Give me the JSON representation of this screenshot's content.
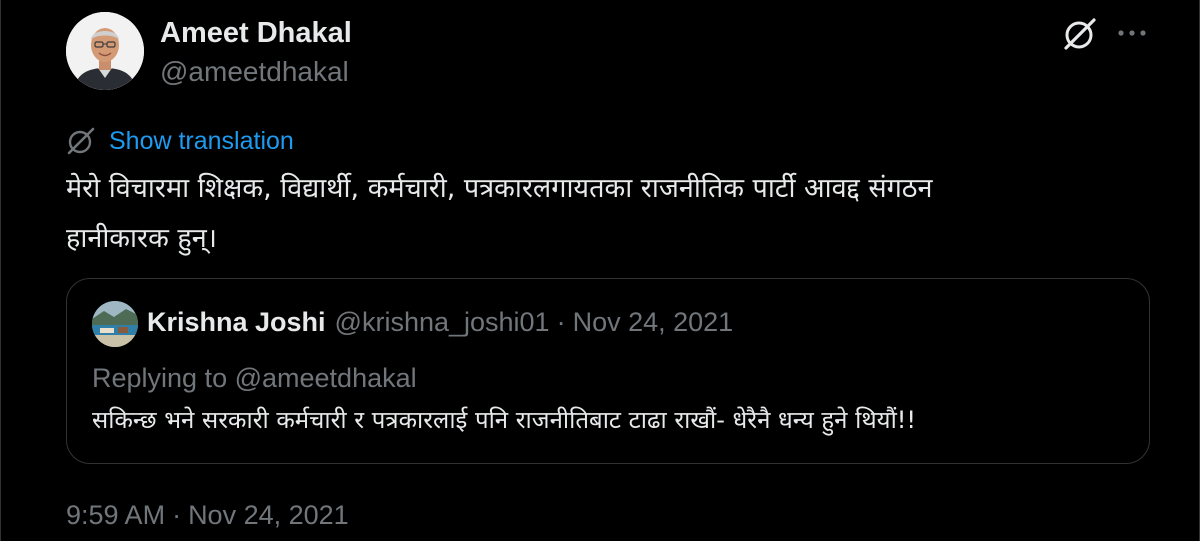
{
  "author": {
    "name": "Ameet Dhakal",
    "handle": "@ameetdhakal"
  },
  "icons": {
    "grok": "grok-icon",
    "more": "more-icon",
    "translate": "grok-icon"
  },
  "translation": {
    "label": "Show translation"
  },
  "tweet": {
    "text_line1": "मेरो विचारमा शिक्षक, विद्यार्थी, कर्मचारी, पत्रकारलगायतका राजनीतिक पार्टी आवद्द संगठन",
    "text_line2": "हानीकारक हुन्।"
  },
  "quote": {
    "name": "Krishna Joshi",
    "handle": "@krishna_joshi01",
    "separator": "·",
    "date": "Nov 24, 2021",
    "replying_prefix": "Replying to",
    "replying_to": "@ameetdhakal",
    "text": "सकिन्छ भने सरकारी कर्मचारी र पत्रकारलाई पनि राजनीतिबाट टाढा राखौं- धेरैनै धन्य हुने थियौं!!"
  },
  "timestamp": {
    "time": "9:59 AM",
    "separator": "·",
    "date": "Nov 24, 2021"
  },
  "colors": {
    "background": "#000000",
    "text_primary": "#e7e9ea",
    "text_secondary": "#71767b",
    "link": "#1d9bf0",
    "border": "#2f3336"
  }
}
